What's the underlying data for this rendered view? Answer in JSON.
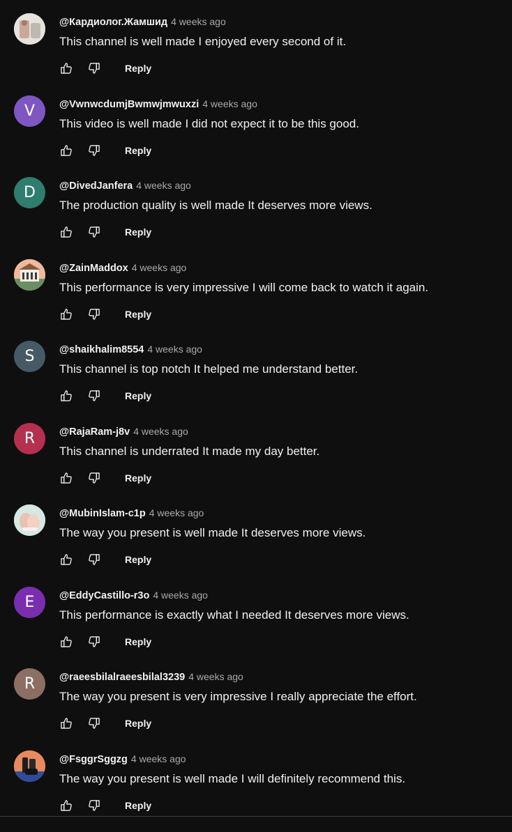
{
  "comments": [
    {
      "author": "@Кардиолог.Жамшид",
      "time": "4 weeks ago",
      "text": "This channel is well made I enjoyed every second of it.",
      "reply_label": "Reply",
      "avatar": {
        "type": "image",
        "color": "#d8d4cf"
      }
    },
    {
      "author": "@VwnwcdumjBwmwjmwuxzi",
      "time": "4 weeks ago",
      "text": "This video is well made I did not expect it to be this good.",
      "reply_label": "Reply",
      "avatar": {
        "type": "letter",
        "letter": "V",
        "color": "#7e57c2"
      }
    },
    {
      "author": "@DivedJanfera",
      "time": "4 weeks ago",
      "text": "The production quality is well made It deserves more views.",
      "reply_label": "Reply",
      "avatar": {
        "type": "letter",
        "letter": "D",
        "color": "#2e7d6e"
      }
    },
    {
      "author": "@ZainMaddox",
      "time": "4 weeks ago",
      "text": "This performance is very impressive I will come back to watch it again.",
      "reply_label": "Reply",
      "avatar": {
        "type": "image",
        "color": "#e8a98a"
      }
    },
    {
      "author": "@shaikhalim8554",
      "time": "4 weeks ago",
      "text": "This channel is top notch It helped me understand better.",
      "reply_label": "Reply",
      "avatar": {
        "type": "letter",
        "letter": "S",
        "color": "#455a64"
      }
    },
    {
      "author": "@RajaRam-j8v",
      "time": "4 weeks ago",
      "text": "This channel is underrated It made my day better.",
      "reply_label": "Reply",
      "avatar": {
        "type": "letter",
        "letter": "R",
        "color": "#b5304f"
      }
    },
    {
      "author": "@MubinIslam-c1p",
      "time": "4 weeks ago",
      "text": "The way you present is well made It deserves more views.",
      "reply_label": "Reply",
      "avatar": {
        "type": "image",
        "color": "#cfe3df"
      }
    },
    {
      "author": "@EddyCastillo-r3o",
      "time": "4 weeks ago",
      "text": "This performance is exactly what I needed It deserves more views.",
      "reply_label": "Reply",
      "avatar": {
        "type": "letter",
        "letter": "E",
        "color": "#7b2db0"
      }
    },
    {
      "author": "@raeesbilalraeesbilal3239",
      "time": "4 weeks ago",
      "text": "The way you present is very impressive I really appreciate the effort.",
      "reply_label": "Reply",
      "avatar": {
        "type": "letter",
        "letter": "R",
        "color": "#8d6e63"
      }
    },
    {
      "author": "@FsggrSggzg",
      "time": "4 weeks ago",
      "text": "The way you present is well made I will definitely recommend this.",
      "reply_label": "Reply",
      "avatar": {
        "type": "image",
        "color": "#e07a4f"
      }
    }
  ]
}
